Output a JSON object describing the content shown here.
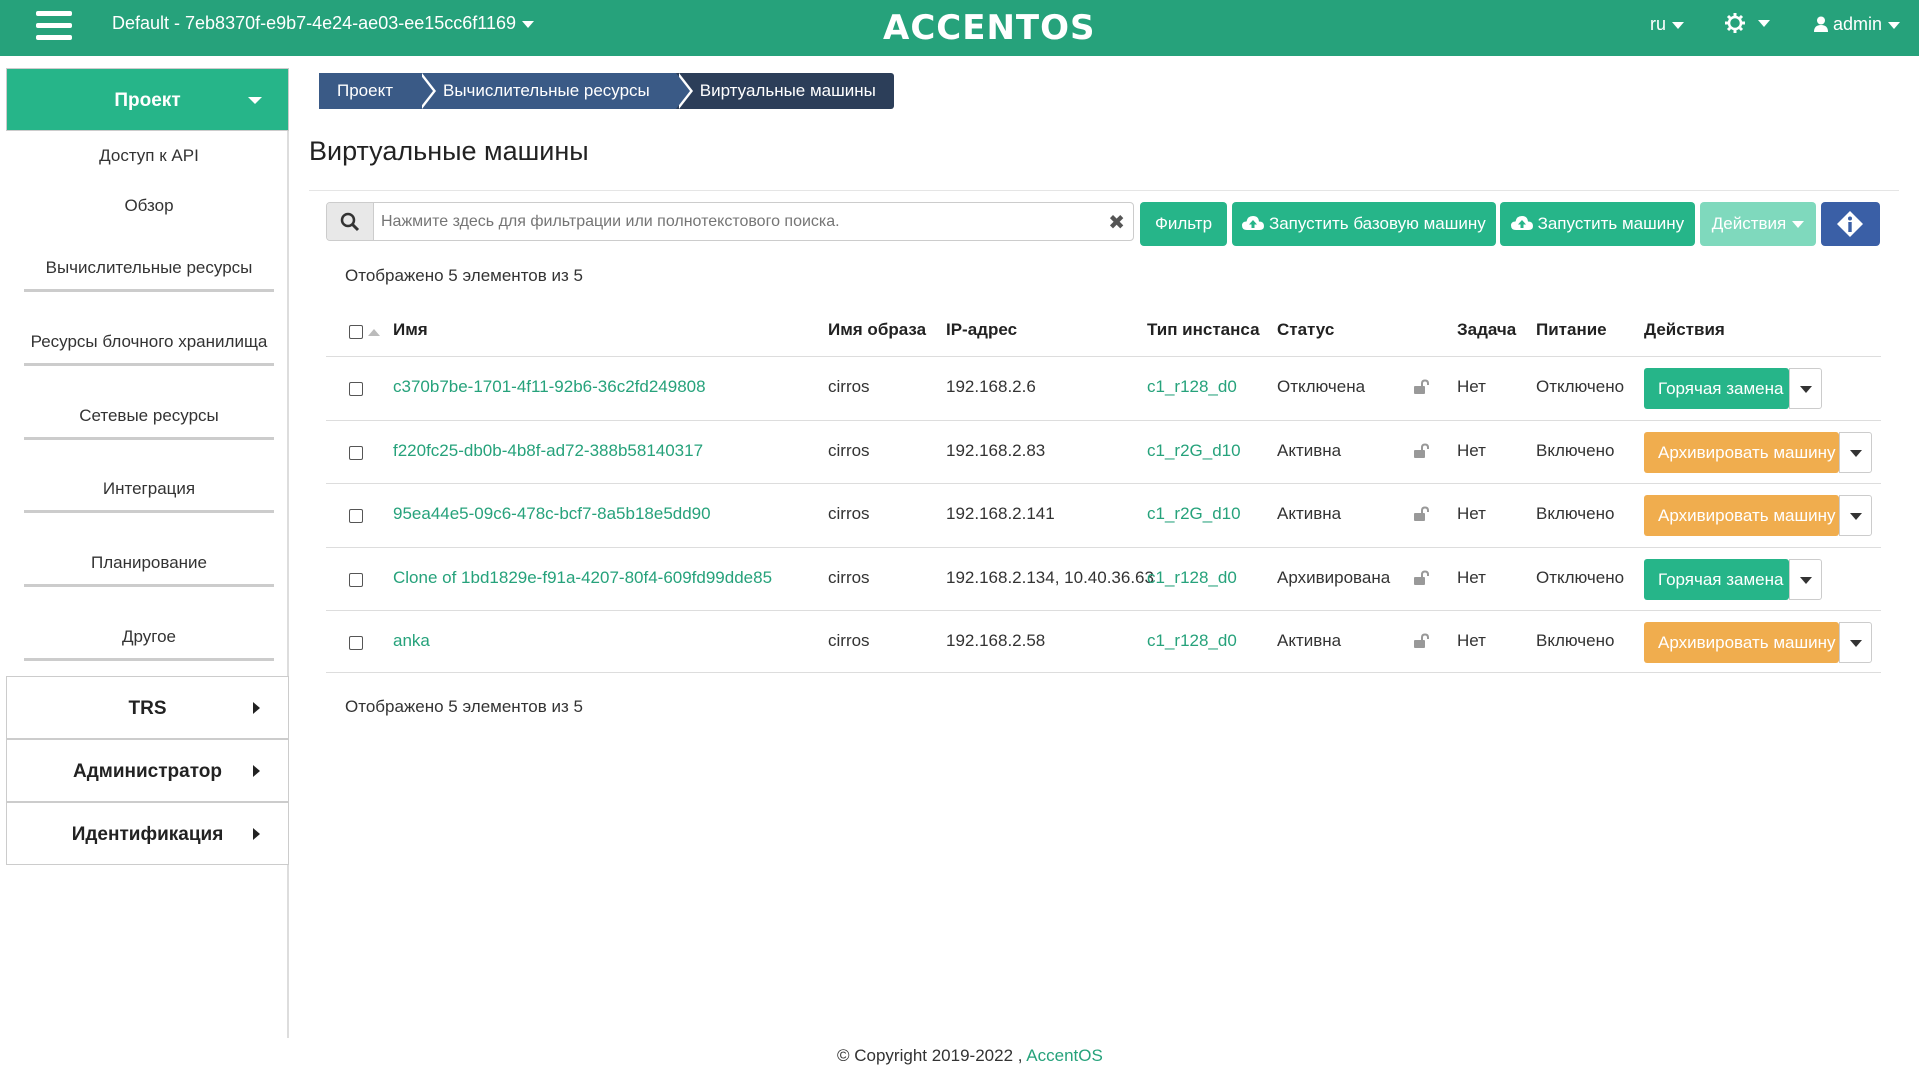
{
  "topbar": {
    "project": "Default - 7eb8370f-e9b7-4e24-ae03-ee15cc6f1169",
    "logo": "ACCENTOS",
    "language": "ru",
    "user": "admin",
    "icons": [
      "menu-icon",
      "gear-icon",
      "user-icon"
    ]
  },
  "sidebar": {
    "project_section": "Проект",
    "items": [
      "Доступ к API",
      "Обзор",
      "Вычислительные ресурсы",
      "Ресурсы блочного хранилища",
      "Сетевые ресурсы",
      "Интеграция",
      "Планирование",
      "Другое"
    ],
    "sections": [
      "TRS",
      "Администратор",
      "Идентификация"
    ]
  },
  "breadcrumb": [
    "Проект",
    "Вычислительные ресурсы",
    "Виртуальные машины"
  ],
  "page_title": "Виртуальные машины",
  "toolbar": {
    "search_placeholder": "Нажмите здесь для фильтрации или полнотекстового поиска.",
    "filter": "Фильтр",
    "launch_base": "Запустить базовую машину",
    "launch": "Запустить машину",
    "actions": "Действия"
  },
  "count_text": "Отображено 5 элементов из 5",
  "table": {
    "headers": [
      "Имя",
      "Имя образа",
      "IP-адрес",
      "Тип инстанса",
      "Статус",
      "Задача",
      "Питание",
      "Действия"
    ],
    "rows": [
      {
        "name": "c370b7be-1701-4f11-92b6-36c2fd249808",
        "image": "cirros",
        "ip": "192.168.2.6",
        "flavor": "c1_r128_d0",
        "status": "Отключена",
        "task": "Нет",
        "power": "Отключено",
        "action": "Горячая замена",
        "action_color": "green"
      },
      {
        "name": "f220fc25-db0b-4b8f-ad72-388b58140317",
        "image": "cirros",
        "ip": "192.168.2.83",
        "flavor": "c1_r2G_d10",
        "status": "Активна",
        "task": "Нет",
        "power": "Включено",
        "action": "Архивировать машину",
        "action_color": "orange"
      },
      {
        "name": "95ea44e5-09c6-478c-bcf7-8a5b18e5dd90",
        "image": "cirros",
        "ip": "192.168.2.141",
        "flavor": "c1_r2G_d10",
        "status": "Активна",
        "task": "Нет",
        "power": "Включено",
        "action": "Архивировать машину",
        "action_color": "orange"
      },
      {
        "name": "Clone of 1bd1829e-f91a-4207-80f4-609fd99dde85",
        "image": "cirros",
        "ip": "192.168.2.134, 10.40.36.63",
        "flavor": "c1_r128_d0",
        "status": "Архивирована",
        "task": "Нет",
        "power": "Отключено",
        "action": "Горячая замена",
        "action_color": "green"
      },
      {
        "name": "anka",
        "image": "cirros",
        "ip": "192.168.2.58",
        "flavor": "c1_r128_d0",
        "status": "Активна",
        "task": "Нет",
        "power": "Включено",
        "action": "Архивировать машину",
        "action_color": "orange"
      }
    ]
  },
  "footer": {
    "copyright": "© Copyright 2019-2022 ,",
    "brand": "AccentOS"
  },
  "colors": {
    "primary": "#26a27b",
    "accent_button": "#26b589",
    "warning": "#f0ad4e",
    "breadcrumb": "#3a5a86",
    "info": "#3a5fa6"
  }
}
